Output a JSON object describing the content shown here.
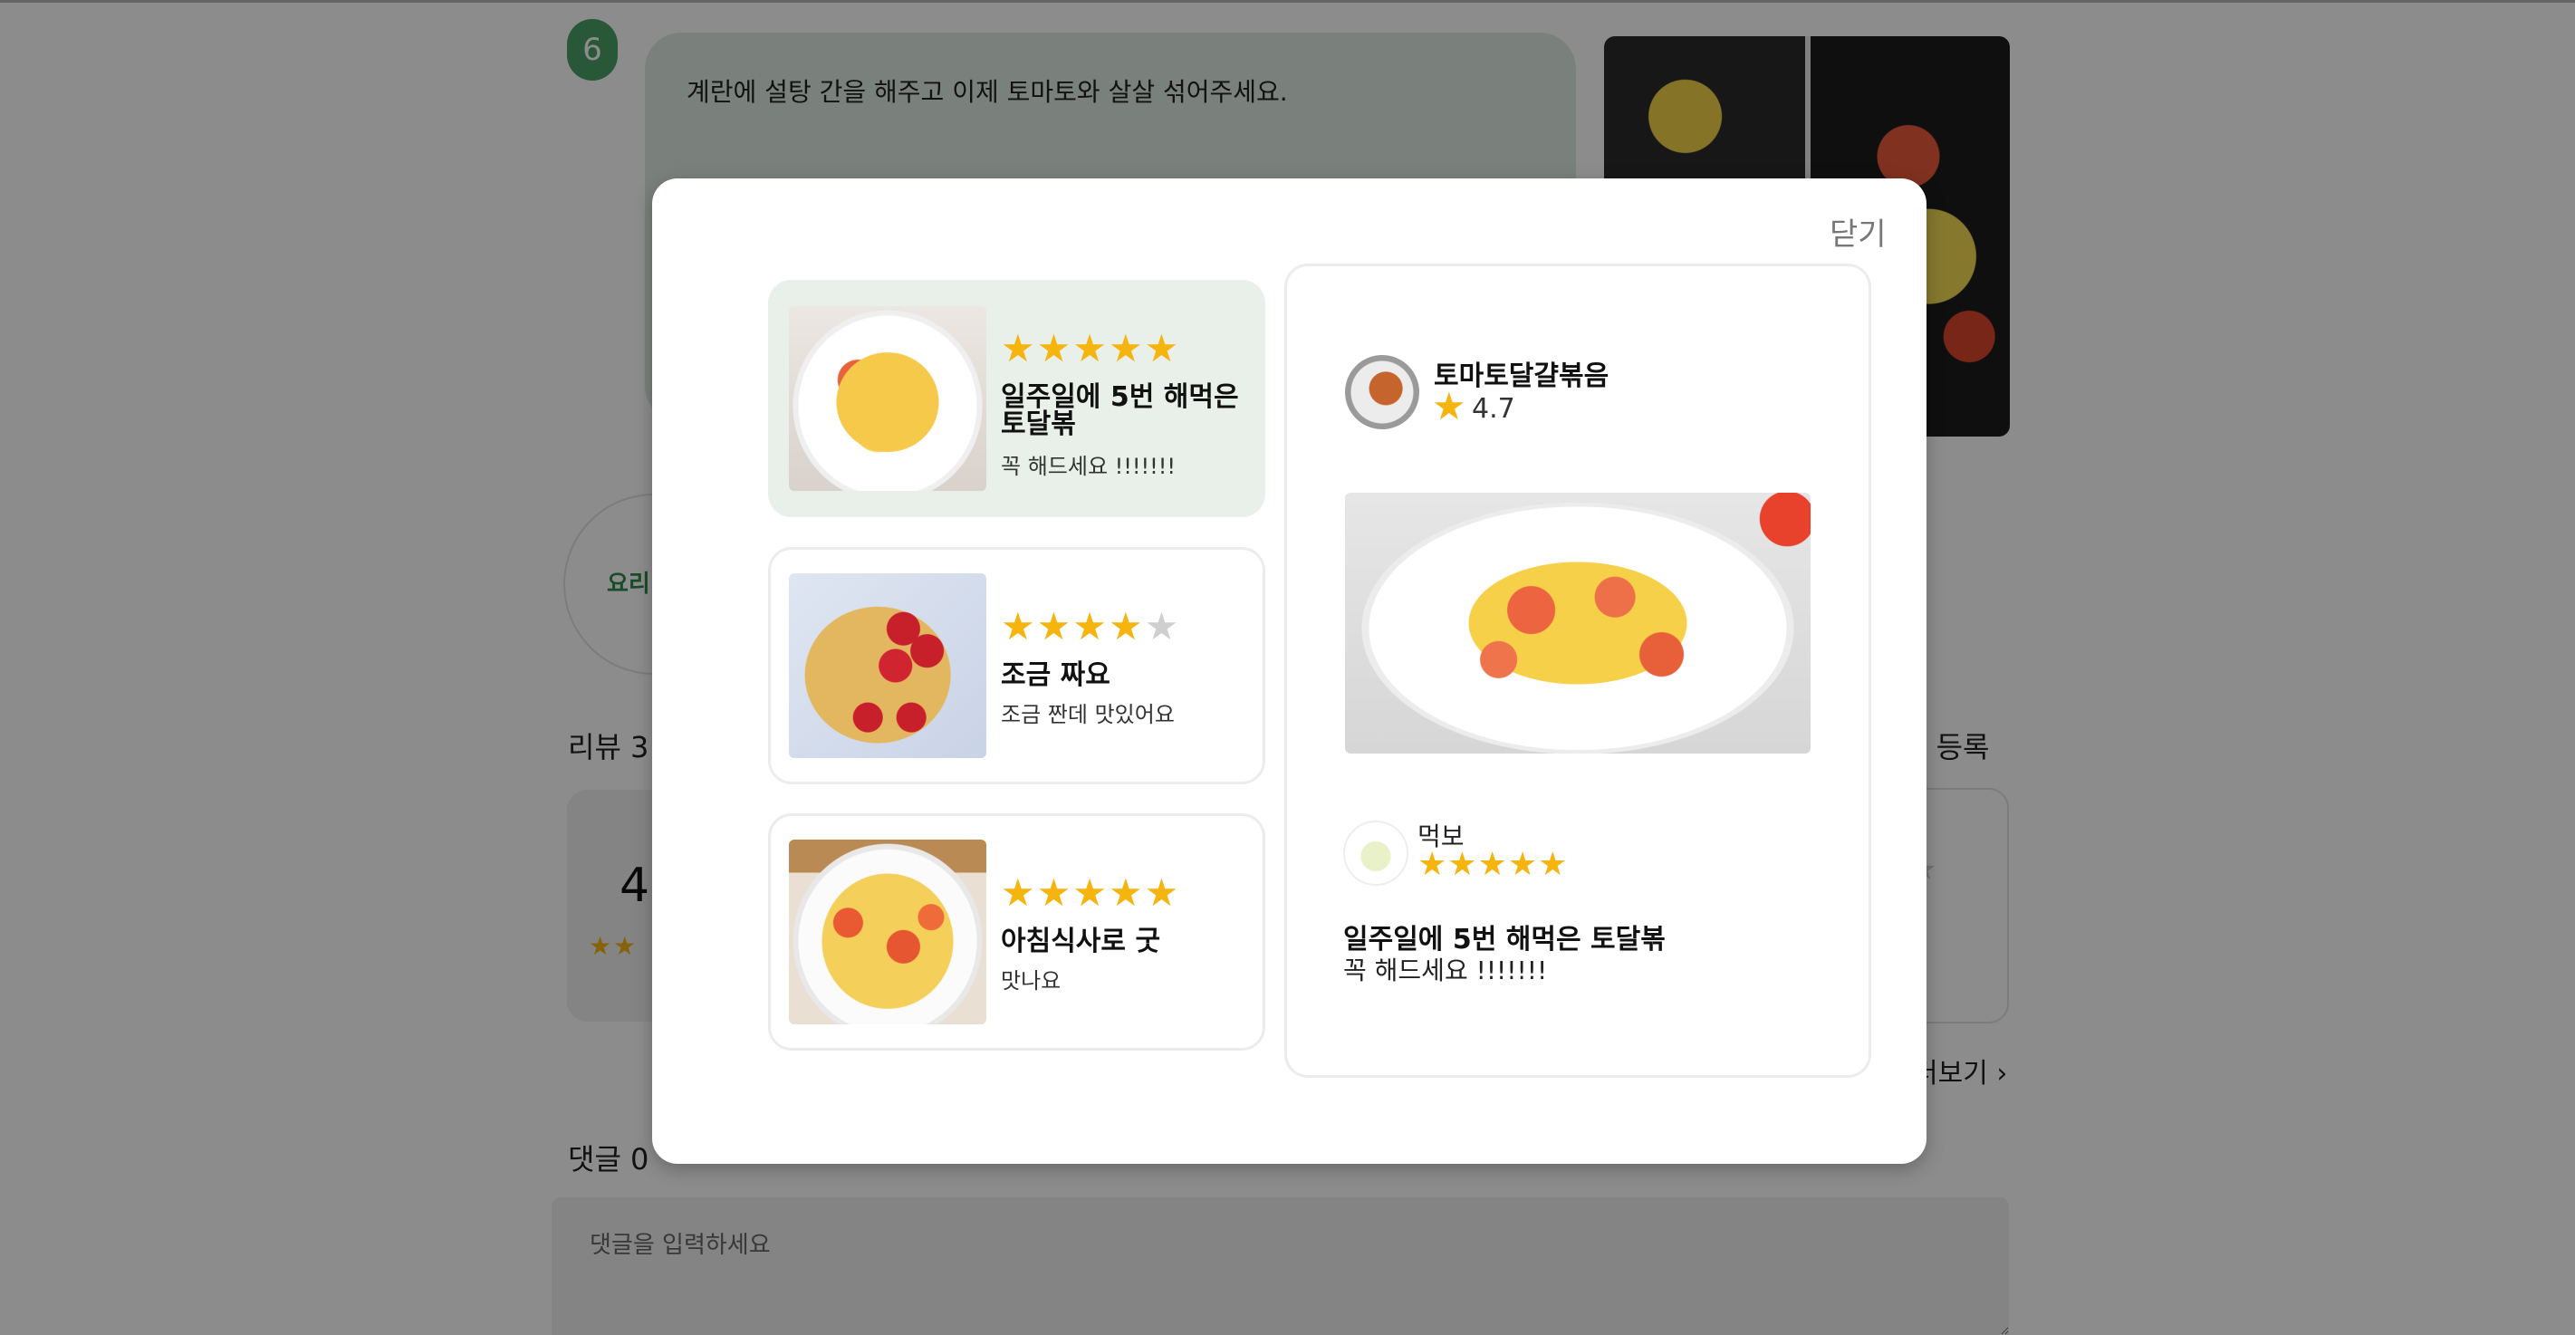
{
  "background": {
    "step": {
      "number": "6",
      "text": "계란에 설탕 간을 해주고 이제 토마토와 살살 섞어주세요."
    },
    "chef_label": "요리",
    "reviews_count": "리뷰 3",
    "review_register": "뷰 등록",
    "summary_score": "4",
    "summary_stars": "★★",
    "more_link": "더보기 ›",
    "comments_count": "댓글 0",
    "comment_placeholder": "댓글을 입력하세요"
  },
  "modal": {
    "close_label": "닫기",
    "reviews": [
      {
        "rating": 5,
        "stars_on": "★★★★★",
        "stars_off": "",
        "title": "일주일에 5번 해먹은 토달볶",
        "body": "꼭 해드세요 !!!!!!!",
        "selected": true
      },
      {
        "rating": 4,
        "stars_on": "★★★★",
        "stars_off": "★",
        "title": "조금 짜요",
        "body": "조금 짠데 맛있어요",
        "selected": false
      },
      {
        "rating": 5,
        "stars_on": "★★★★★",
        "stars_off": "",
        "title": "아침식사로 굿",
        "body": "맛나요",
        "selected": false
      }
    ],
    "detail": {
      "recipe_name": "토마토달걀볶음",
      "recipe_rating": "4.7",
      "recipe_star": "★",
      "user_name": "먹보",
      "user_stars": "★★★★★",
      "title": "일주일에 5번 해먹은 토달볶",
      "body": "꼭 해드세요 !!!!!!!"
    }
  },
  "colors": {
    "accent_green": "#49a164",
    "star": "#f5b40e",
    "star_off": "#cfcfcf",
    "selected_card_bg": "#e9efe9"
  }
}
